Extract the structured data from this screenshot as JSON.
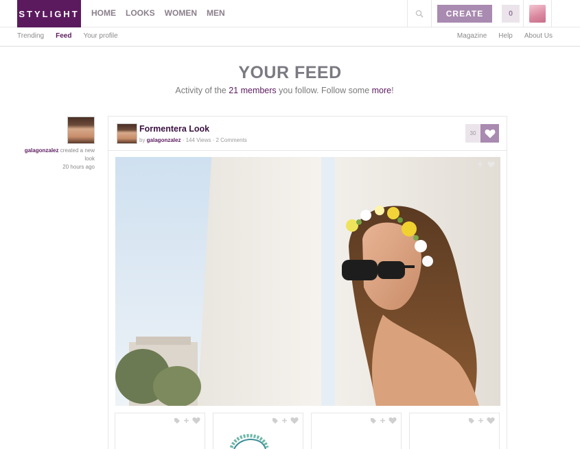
{
  "brand": {
    "logo_text": "STYLIGHT",
    "color": "#5b1a5e",
    "accent": "#a98ab0"
  },
  "main_nav": [
    "HOME",
    "LOOKS",
    "WOMEN",
    "MEN"
  ],
  "header": {
    "create_label": "CREATE",
    "cart_count": "0",
    "search_icon": "search-icon"
  },
  "sub_nav": {
    "left": [
      {
        "label": "Trending",
        "active": false
      },
      {
        "label": "Feed",
        "active": true
      },
      {
        "label": "Your profile",
        "active": false
      }
    ],
    "right": [
      "Magazine",
      "Help",
      "About Us"
    ]
  },
  "feed": {
    "title": "YOUR FEED",
    "subtitle_prefix": "Activity of the ",
    "members_link": "21 members",
    "subtitle_middle": " you follow. Follow some ",
    "more_link": "more",
    "subtitle_suffix": "!"
  },
  "activity": {
    "user": "galagonzalez",
    "action": " created a new look",
    "time": "20 hours ago"
  },
  "card": {
    "title": "Formentera Look",
    "by_label": "by ",
    "user": "galagonzalez",
    "views": " · 144 Views · ",
    "comments": "2 Comments",
    "likes": "30"
  },
  "thumbnails": [
    {
      "icons": [
        "tag-icon",
        "plus-icon",
        "heart-icon"
      ]
    },
    {
      "icons": [
        "tag-icon",
        "plus-icon",
        "heart-icon"
      ]
    },
    {
      "icons": [
        "tag-icon",
        "plus-icon",
        "heart-icon"
      ]
    },
    {
      "icons": [
        "tag-icon",
        "plus-icon",
        "heart-icon"
      ]
    }
  ]
}
